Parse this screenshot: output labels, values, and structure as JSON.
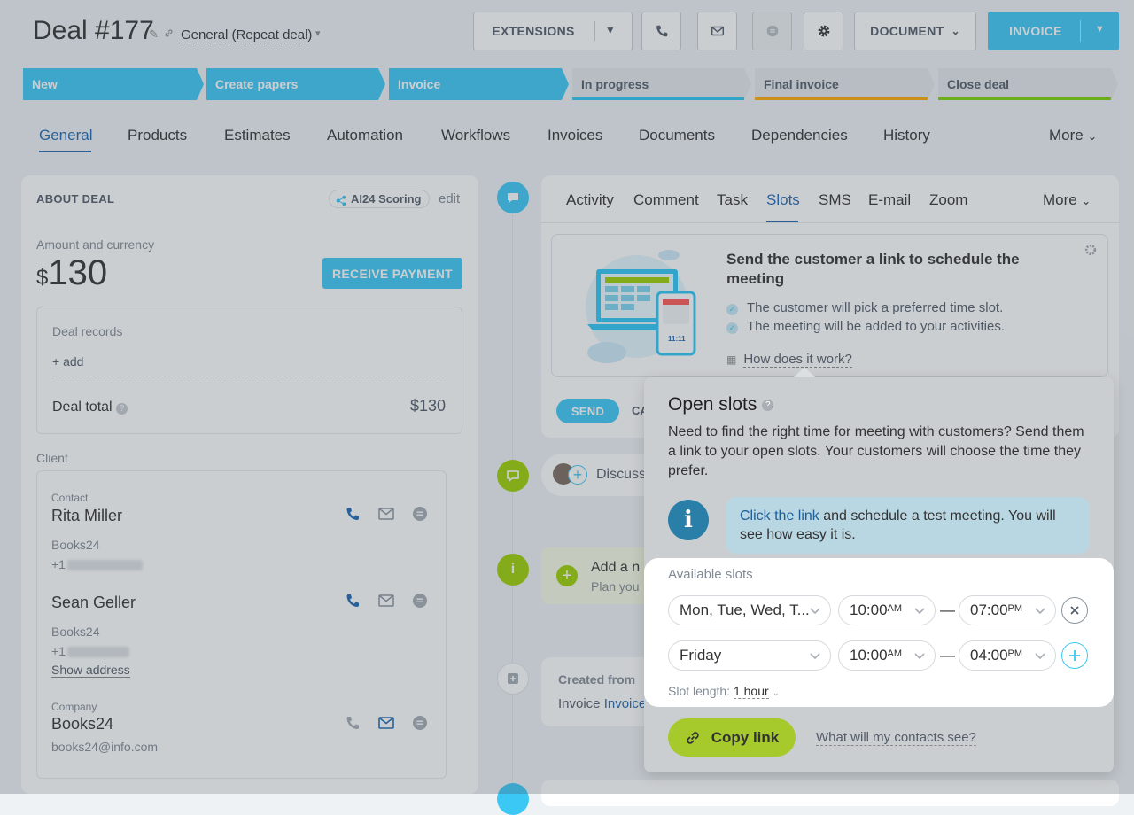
{
  "header": {
    "title": "Deal #177",
    "pipeline": "General (Repeat deal)",
    "extensions_label": "EXTENSIONS",
    "document_label": "DOCUMENT",
    "invoice_label": "INVOICE"
  },
  "stages": [
    {
      "label": "New",
      "state": "done"
    },
    {
      "label": "Create papers",
      "state": "done"
    },
    {
      "label": "Invoice",
      "state": "current"
    },
    {
      "label": "In progress",
      "state": "pending",
      "bar": "#2fc6f6"
    },
    {
      "label": "Final invoice",
      "state": "pending",
      "bar": "#ffa900"
    },
    {
      "label": "Close deal",
      "state": "pending",
      "bar": "#7bd500"
    }
  ],
  "tabs": [
    "General",
    "Products",
    "Estimates",
    "Automation",
    "Workflows",
    "Invoices",
    "Documents",
    "Dependencies",
    "History",
    "More"
  ],
  "about": {
    "heading": "ABOUT DEAL",
    "ai_badge": "AI24 Scoring",
    "edit": "edit",
    "amount_label": "Amount and currency",
    "currency": "$",
    "amount": "130",
    "receive_payment": "RECEIVE PAYMENT",
    "records_label": "Deal records",
    "add": "+ add",
    "total_label": "Deal total",
    "total_value": "$130",
    "client_label": "Client"
  },
  "contacts": [
    {
      "type": "Contact",
      "name": "Rita Miller",
      "company": "Books24",
      "phone": "+1"
    },
    {
      "name": "Sean Geller",
      "company": "Books24",
      "phone": "+1",
      "address_link": "Show address"
    },
    {
      "type": "Company",
      "name": "Books24",
      "email": "books24@info.com"
    }
  ],
  "activity_tabs": [
    "Activity",
    "Comment",
    "Task",
    "Slots",
    "SMS",
    "E-mail",
    "Zoom",
    "More"
  ],
  "slots_panel": {
    "title": "Send the customer a link to schedule the meeting",
    "bullets": [
      "The customer will pick a preferred time slot.",
      "The meeting will be added to your activities."
    ],
    "how_link": "How does it work?",
    "send": "SEND",
    "cancel_partial": "CA",
    "illustration_time": "11:11"
  },
  "timeline": {
    "discuss_partial": "Discuss",
    "add_partial": "Add a n",
    "plan_partial": "Plan you",
    "created_from": "Created from",
    "invoice_prefix": "Invoice",
    "invoice_link": "Invoice"
  },
  "popup": {
    "title": "Open slots",
    "description": "Need to find the right time for meeting with customers? Send them a link to your open slots. Your customers will choose the time they prefer.",
    "hint_link": "Click the link",
    "hint_rest": " and schedule a test meeting. You will see how easy it is.",
    "available_label": "Available slots",
    "rows": [
      {
        "days": "Mon, Tue, Wed, T...",
        "from": "10:00",
        "from_ampm": "AM",
        "to": "07:00",
        "to_ampm": "PM",
        "action": "remove"
      },
      {
        "days": "Friday",
        "from": "10:00",
        "from_ampm": "AM",
        "to": "04:00",
        "to_ampm": "PM",
        "action": "add"
      }
    ],
    "slot_length_label": "Slot length:",
    "slot_length_value": "1 hour",
    "copy_link": "Copy link",
    "contacts_see": "What will my contacts see?"
  },
  "colors": {
    "accent": "#3bc8f5",
    "link": "#2067b0",
    "green": "#bbed21",
    "timeline_blue": "#3bc8f5",
    "timeline_green": "#9dcf00"
  }
}
